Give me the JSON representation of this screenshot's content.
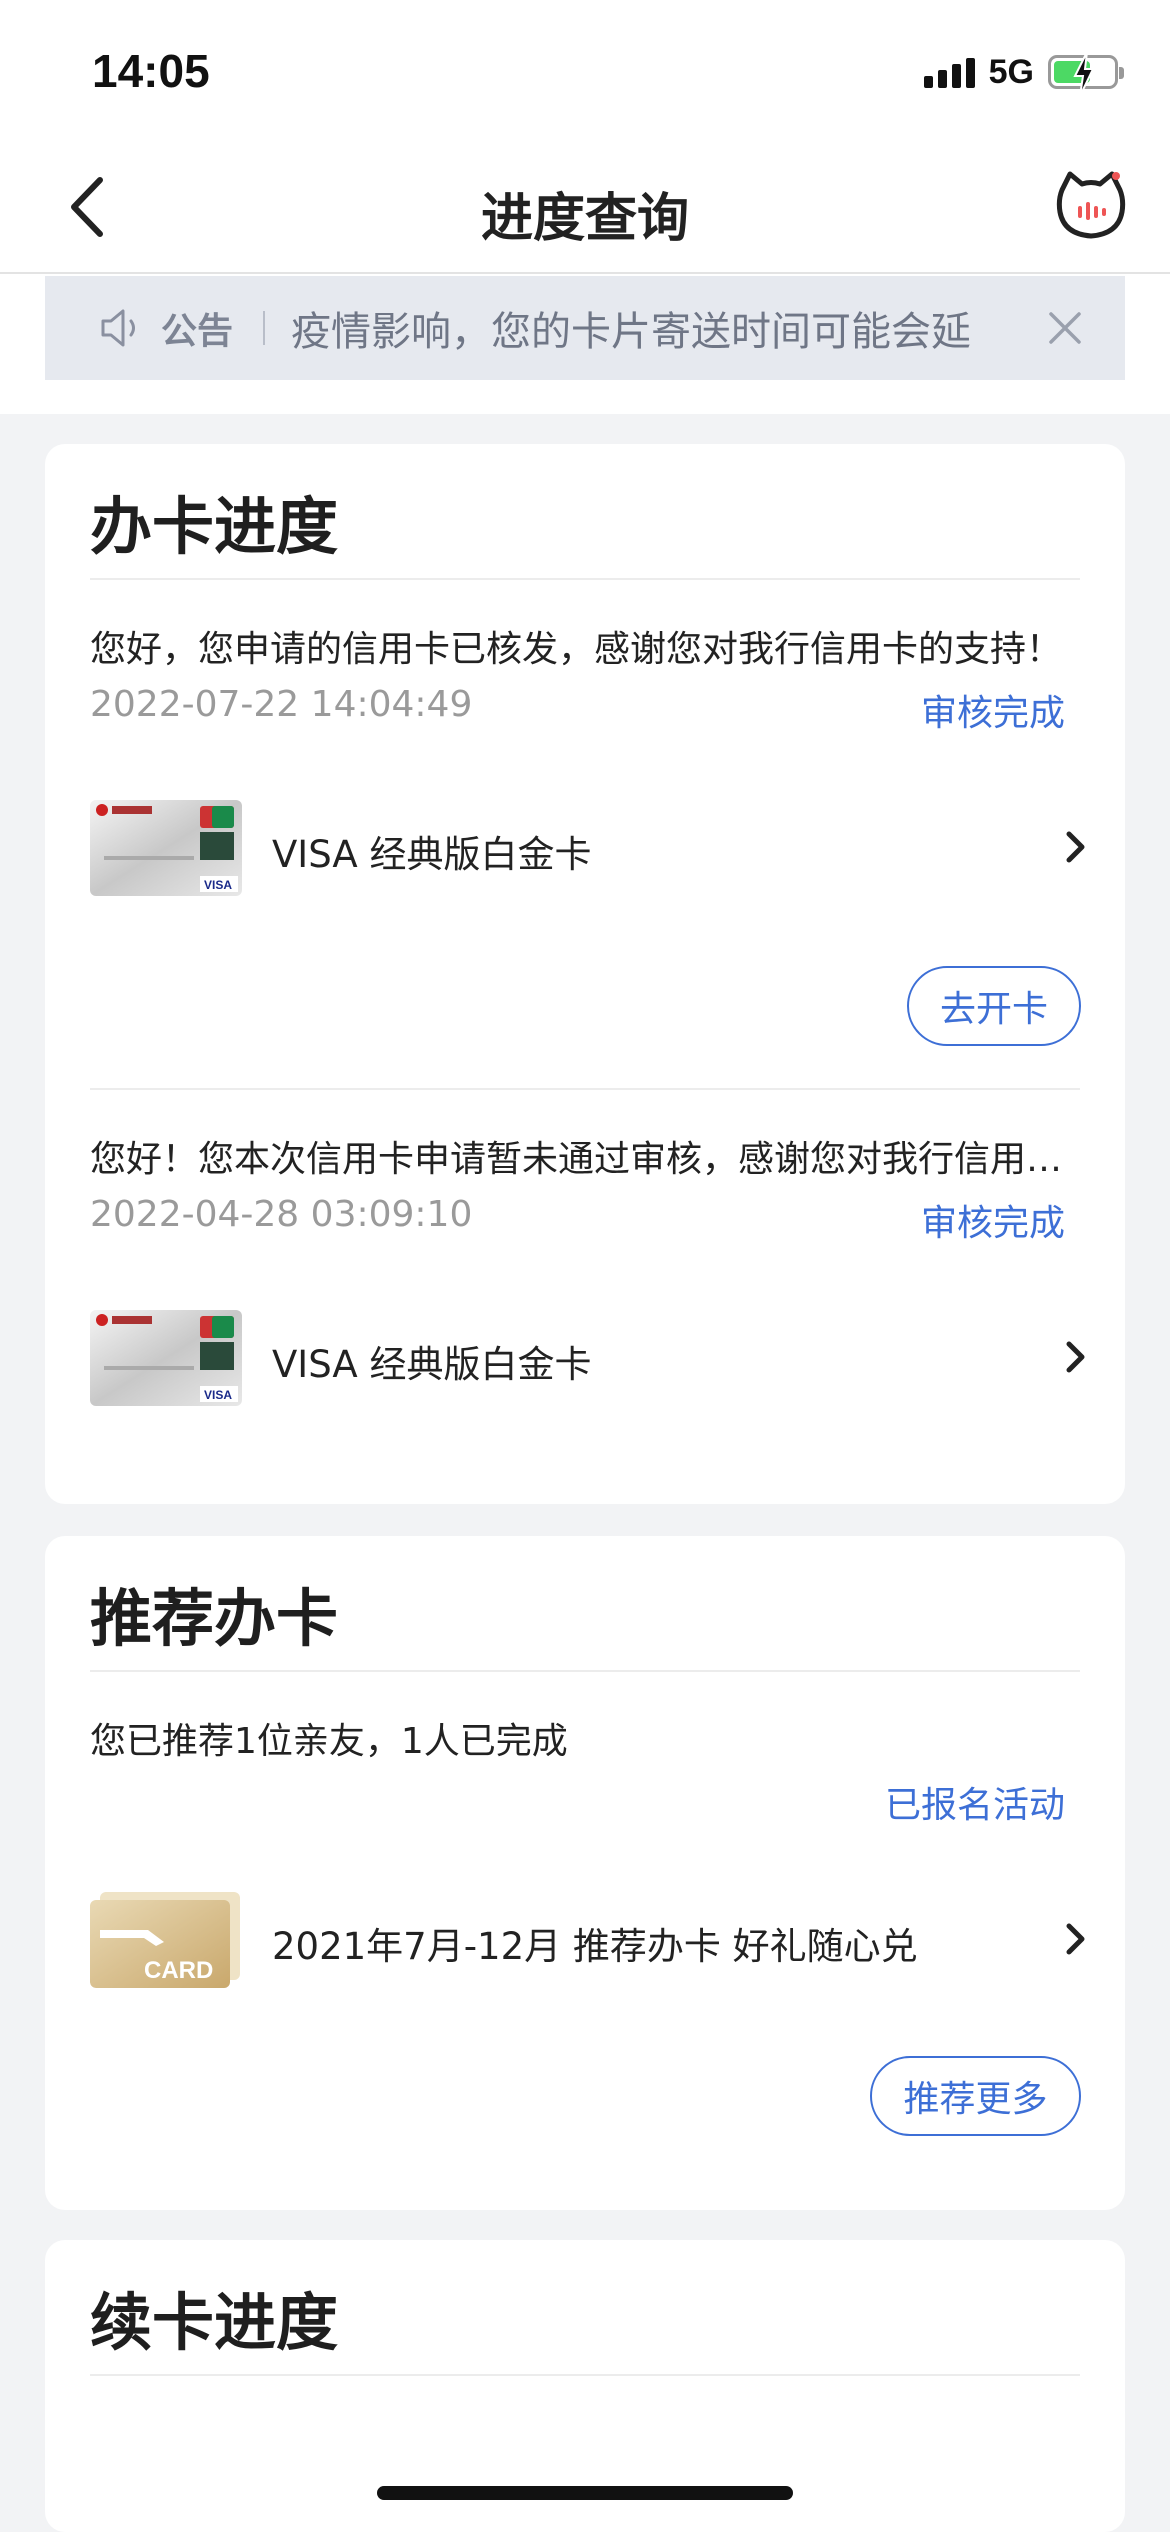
{
  "status_bar": {
    "time": "14:05",
    "network": "5G"
  },
  "nav": {
    "title": "进度查询"
  },
  "notice": {
    "label": "公告",
    "text": "疫情影响，您的卡片寄送时间可能会延"
  },
  "apply_progress": {
    "title": "办卡进度",
    "items": [
      {
        "message": "您好，您申请的信用卡已核发，感谢您对我行信用卡的支持！",
        "time": "2022-07-22 14:04:49",
        "status": "审核完成",
        "card_name": "VISA 经典版白金卡",
        "action": "去开卡"
      },
      {
        "message": "您好！您本次信用卡申请暂未通过审核，感谢您对我行信用卡的支持！",
        "time": "2022-04-28 03:09:10",
        "status": "审核完成",
        "card_name": "VISA 经典版白金卡"
      }
    ]
  },
  "recommend": {
    "title": "推荐办卡",
    "summary": "您已推荐1位亲友，1人已完成",
    "status": "已报名活动",
    "activity_name": "2021年7月-12月 推荐办卡 好礼随心兑",
    "thumb_text": "CARD",
    "action": "推荐更多"
  },
  "renew": {
    "title": "续卡进度"
  },
  "colors": {
    "accent": "#3d6fd6",
    "background": "#f2f3f5",
    "notice_bg": "#e6e9ef"
  }
}
